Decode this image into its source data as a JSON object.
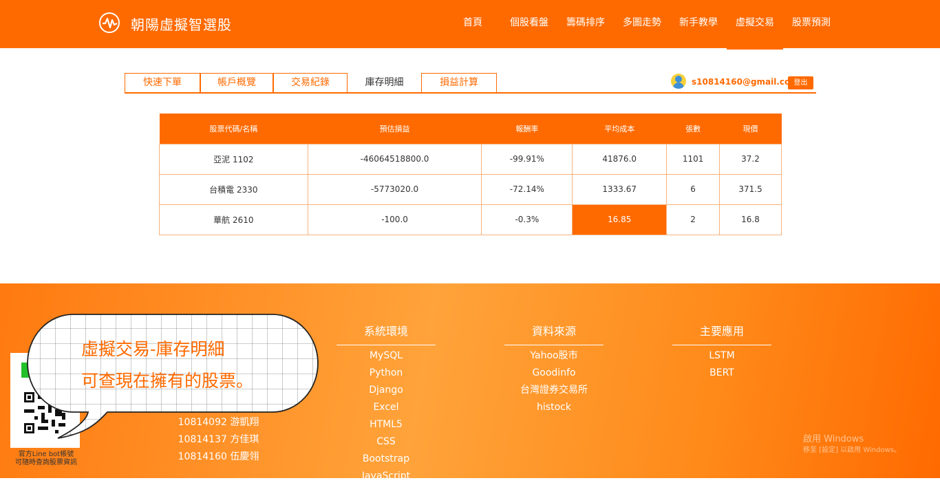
{
  "header": {
    "brand": "朝陽虛擬智選股",
    "nav": [
      {
        "label": "首頁"
      },
      {
        "label": "個股看盤"
      },
      {
        "label": "籌碼排序"
      },
      {
        "label": "多圖走勢"
      },
      {
        "label": "新手教學"
      },
      {
        "label": "虛擬交易"
      },
      {
        "label": "股票預測"
      }
    ],
    "active_nav": "虛擬交易"
  },
  "tabs": [
    {
      "label": "快速下單"
    },
    {
      "label": "帳戶概覽"
    },
    {
      "label": "交易紀錄"
    },
    {
      "label": "庫存明細"
    },
    {
      "label": "損益計算"
    }
  ],
  "active_tab": "庫存明細",
  "user": {
    "email": "s10814160@gmail.com",
    "logout_label": "登出"
  },
  "table": {
    "headers": [
      "股票代碼/名稱",
      "預估損益",
      "報酬率",
      "平均成本",
      "張數",
      "現價"
    ],
    "rows": [
      [
        "亞泥 1102",
        "-46064518800.0",
        "-99.91%",
        "41876.0",
        "1101",
        "37.2"
      ],
      [
        "台積電 2330",
        "-5773020.0",
        "-72.14%",
        "1333.67",
        "6",
        "371.5"
      ],
      [
        "華航 2610",
        "-100.0",
        "-0.3%",
        "16.85",
        "2",
        "16.8"
      ]
    ]
  },
  "footer": {
    "columns": [
      {
        "title": "系統環境",
        "items": [
          "MySQL",
          "Python",
          "Django",
          "Excel",
          "HTML5",
          "CSS",
          "Bootstrap",
          "JavaScript"
        ]
      },
      {
        "title": "資料來源",
        "items": [
          "Yahoo股市",
          "Goodinfo",
          "台灣證券交易所",
          "histock"
        ]
      },
      {
        "title": "主要應用",
        "items": [
          "LSTM",
          "BERT"
        ]
      }
    ],
    "team": [
      "10814092 游凱翔",
      "10814137 方佳琪",
      "10814160 伍慶翎"
    ],
    "qr_caption": [
      "官方Line bot帳號",
      "可隨時查詢股票資訊"
    ],
    "bubble_lines": [
      "虛擬交易-庫存明細",
      "可查現在擁有的股票。"
    ],
    "watermark": [
      "啟用 Windows",
      "移至 [設定] 以啟用 Windows。"
    ]
  },
  "colors": {
    "accent": "#ff6a00",
    "highlight_cell": "#ff6a00"
  }
}
